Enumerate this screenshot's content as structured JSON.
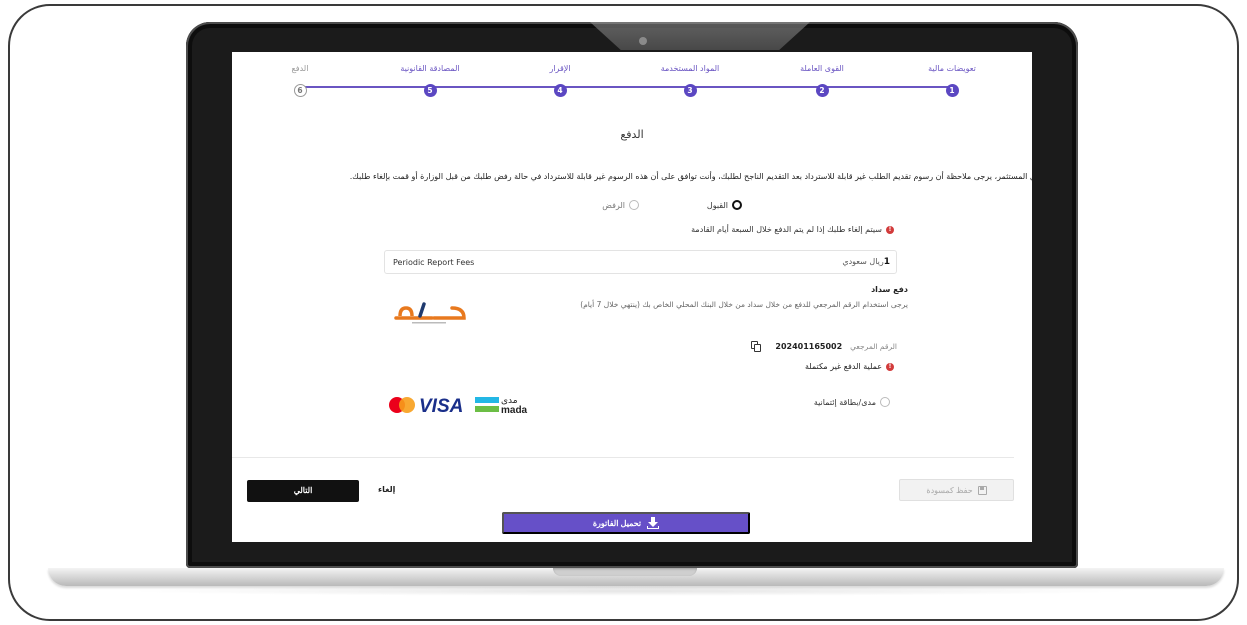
{
  "stepper": {
    "steps": [
      {
        "label": "تعويضات مالية",
        "number": "1"
      },
      {
        "label": "القوى العاملة",
        "number": "2"
      },
      {
        "label": "المواد المستخدمة",
        "number": "3"
      },
      {
        "label": "الإقرار",
        "number": "4"
      },
      {
        "label": "المصادقة القانونية",
        "number": "5"
      },
      {
        "label": "الدفع",
        "number": "6"
      }
    ],
    "current_step": 6
  },
  "page": {
    "title": "الدفع",
    "notice": "عزيزي المستثمر، يرجى ملاحظة أن رسوم تقديم الطلب غير قابلة للاسترداد بعد التقديم الناجح لطلبك، وأنت توافق على أن هذه الرسوم غير قابلة للاسترداد في حالة رفض طلبك من قبل الوزارة أو قمت بإلغاء طلبك."
  },
  "consent": {
    "accept_label": "القبول",
    "reject_label": "الرفض",
    "selected": "accept"
  },
  "warning": {
    "text": "سيتم إلغاء طلبك إذا لم يتم الدفع خلال السبعة أيام القادمة"
  },
  "fee": {
    "name": "Periodic Report Fees",
    "amount": "1",
    "currency": "ريال سعودي"
  },
  "sadad": {
    "title": "دفع سداد",
    "description": "يرجى استخدام الرقم المرجعي للدفع من خلال سداد من خلال البنك المحلي الخاص بك (ينتهي خلال 7 أيام)",
    "logo_text": "سداد",
    "reference_label": "الرقم المرجعي",
    "reference_value": "202401165002"
  },
  "payment_status": {
    "text": "عملية الدفع غير مكتملة"
  },
  "card_option": {
    "label": "مدى/بطاقة إئتمانية",
    "brands": [
      "mastercard",
      "VISA",
      "mada"
    ],
    "mada_ar": "مدى",
    "mada_en": "mada",
    "visa_text": "VISA"
  },
  "actions": {
    "next_label": "التالي",
    "cancel_label": "إلغاء",
    "save_draft_label": "حفظ كمسودة",
    "download_invoice_label": "تحميل الفاتورة"
  },
  "colors": {
    "accent": "#5b47c2",
    "invoice_button": "#6650c8",
    "sadad_orange": "#e8791e",
    "sadad_navy": "#1f3a6e",
    "visa_blue": "#1a2f8a",
    "mastercard_red": "#eb001b",
    "mastercard_orange": "#f79e1b",
    "warning_red": "#d23b3b"
  }
}
